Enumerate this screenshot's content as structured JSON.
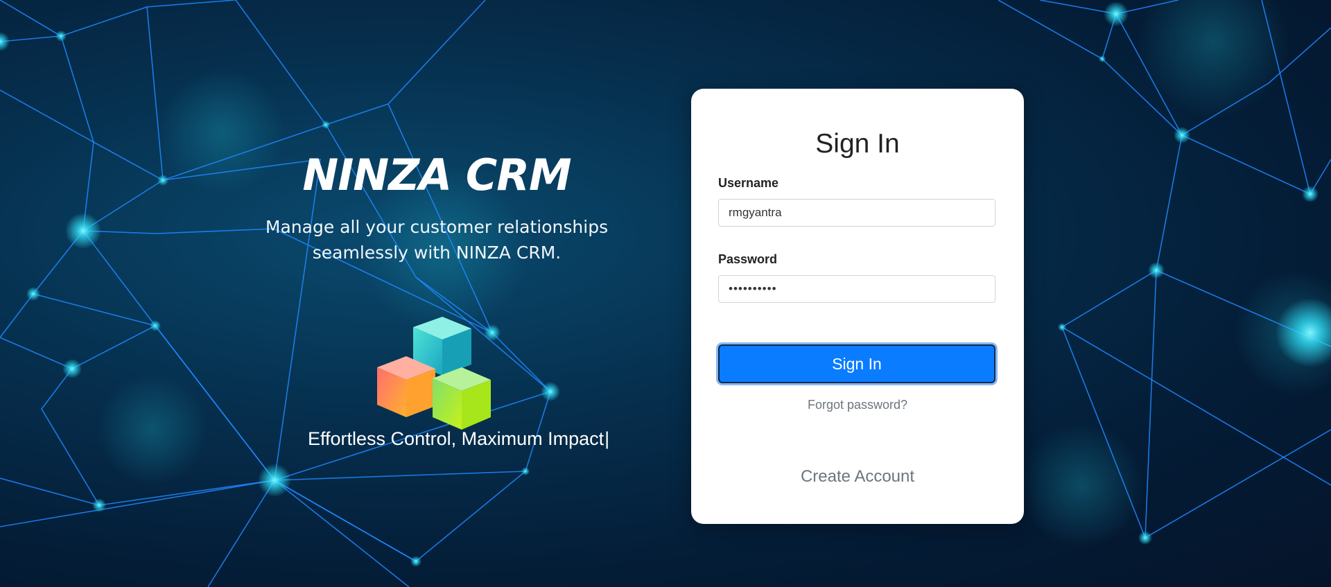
{
  "brand": {
    "title": "NINZA CRM",
    "tagline_line1": "Manage all your customer relationships",
    "tagline_line2": "seamlessly with NINZA CRM.",
    "slogan": "Effortless Control, Maximum Impact",
    "slogan_caret": "|"
  },
  "login": {
    "title": "Sign In",
    "username_label": "Username",
    "username_value": "rmgyantra",
    "password_label": "Password",
    "password_value": "••••••••••",
    "submit_label": "Sign In",
    "forgot_label": "Forgot password?",
    "create_label": "Create Account"
  },
  "colors": {
    "background": "#06304f",
    "network_line": "#1e88ff",
    "network_node": "#38e8ff",
    "primary_button": "#0a7cff",
    "muted_link": "#6c757d"
  }
}
